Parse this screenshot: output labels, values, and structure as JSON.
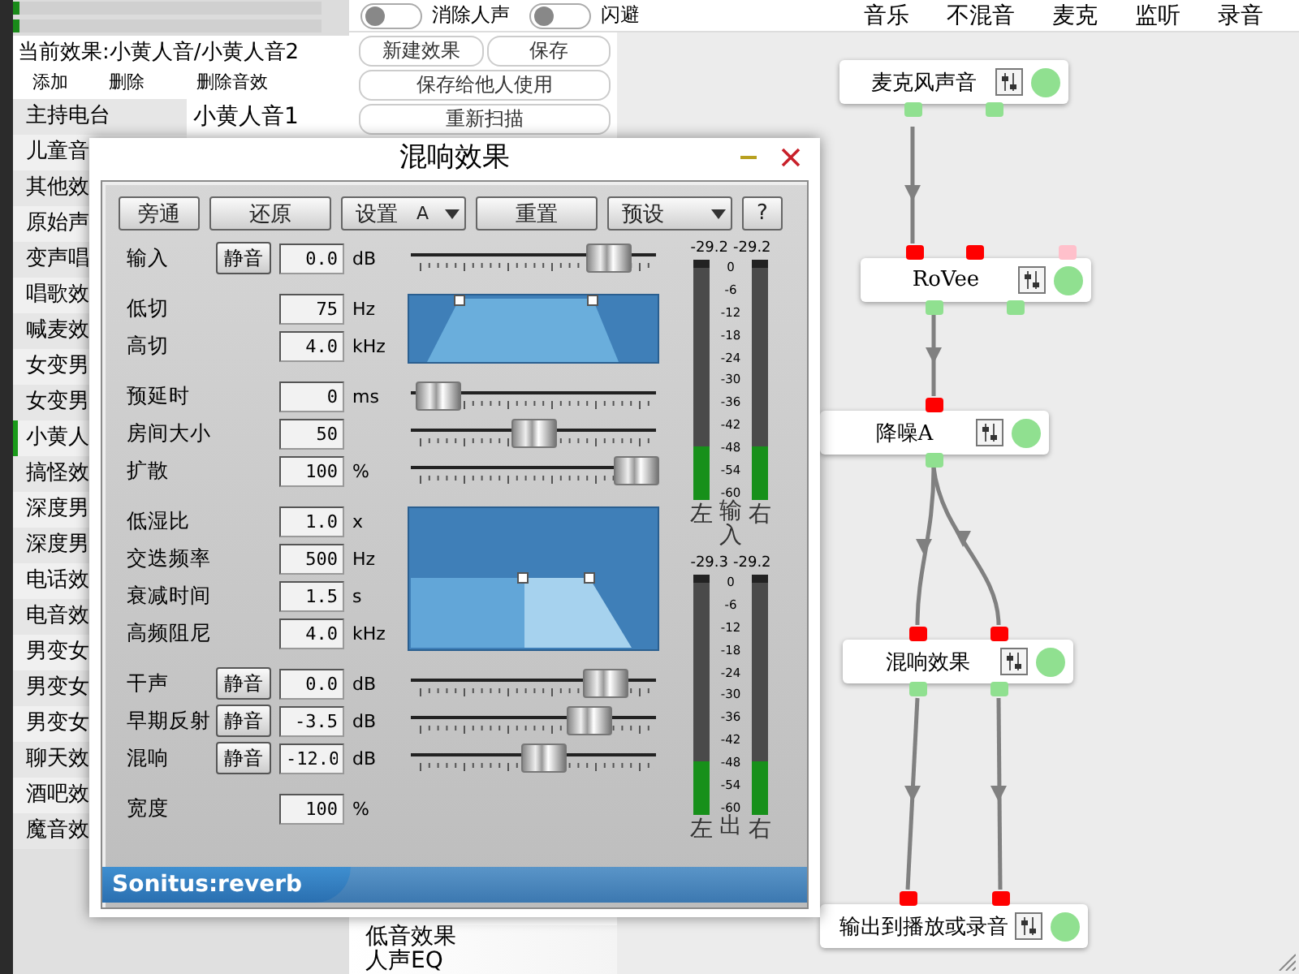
{
  "top_meters": [
    {
      "level": 0.02
    },
    {
      "level": 0.02
    }
  ],
  "current_effect": "当前效果:小黄人音/小黄人音2",
  "effect_actions": [
    "添加",
    "删除",
    "删除音效"
  ],
  "effect_list": [
    {
      "label": "主持电台",
      "selected": false
    },
    {
      "label": "儿童音",
      "selected": false
    },
    {
      "label": "其他效",
      "selected": false
    },
    {
      "label": "原始声",
      "selected": false
    },
    {
      "label": "变声唱",
      "selected": false
    },
    {
      "label": "唱歌效",
      "selected": false
    },
    {
      "label": "喊麦效",
      "selected": false
    },
    {
      "label": "女变男",
      "selected": false
    },
    {
      "label": "女变男",
      "selected": false
    },
    {
      "label": "小黄人",
      "selected": true
    },
    {
      "label": "搞怪效",
      "selected": false
    },
    {
      "label": "深度男",
      "selected": false
    },
    {
      "label": "深度男",
      "selected": false
    },
    {
      "label": "电话效",
      "selected": false
    },
    {
      "label": "电音效",
      "selected": false
    },
    {
      "label": "男变女",
      "selected": false
    },
    {
      "label": "男变女",
      "selected": false
    },
    {
      "label": "男变女",
      "selected": false
    },
    {
      "label": "聊天效",
      "selected": false
    },
    {
      "label": "酒吧效",
      "selected": false
    },
    {
      "label": "魔音效",
      "selected": false
    }
  ],
  "sub_list": [
    {
      "label": "小黄人音1"
    }
  ],
  "top_toggles": [
    {
      "label": "消除人声",
      "on": false
    },
    {
      "label": "闪避",
      "on": false
    }
  ],
  "output_tabs": [
    "音乐",
    "不混音",
    "麦克",
    "监听",
    "录音"
  ],
  "buttons": [
    "新建效果",
    "保存",
    "保存给他人使用",
    "重新扫描"
  ],
  "bottom_list": [
    "低音效果",
    "人声EQ"
  ],
  "graph": {
    "nodes": [
      {
        "label": "麦克风声音",
        "on": true,
        "outputs": [
          {
            "color": "#90e090"
          },
          {
            "color": "#90e090"
          }
        ]
      },
      {
        "label": "RoVee",
        "on": true,
        "inputs": [
          {
            "color": "#ff0000"
          },
          {
            "color": "#ff0000"
          },
          {
            "color": "#ffc0cb"
          }
        ],
        "outputs": [
          {
            "color": "#90e090"
          },
          {
            "color": "#90e090"
          }
        ]
      },
      {
        "label": "降噪A",
        "on": true,
        "inputs": [
          {
            "color": "#ff0000"
          }
        ],
        "outputs": [
          {
            "color": "#90e090"
          }
        ]
      },
      {
        "label": "混响效果",
        "on": true,
        "inputs": [
          {
            "color": "#ff0000"
          },
          {
            "color": "#ff0000"
          }
        ],
        "outputs": [
          {
            "color": "#90e090"
          },
          {
            "color": "#90e090"
          }
        ]
      },
      {
        "label": "输出到播放或录音",
        "on": true,
        "inputs": [
          {
            "color": "#ff0000"
          },
          {
            "color": "#ff0000"
          }
        ]
      }
    ]
  },
  "dialog": {
    "title": "混响效果",
    "toolbar": [
      {
        "kind": "button",
        "label": "旁通"
      },
      {
        "kind": "button",
        "label": "还原"
      },
      {
        "kind": "dropdown",
        "label": "设置",
        "value": "A"
      },
      {
        "kind": "button",
        "label": "重置"
      },
      {
        "kind": "dropdown",
        "label": "预设"
      },
      {
        "kind": "button",
        "label": "?"
      }
    ],
    "sections": [
      {
        "kind": "sliders",
        "rows": [
          {
            "label": "输入",
            "mute": "静音",
            "value": "0.0",
            "unit": "dB",
            "level": 0.87
          }
        ]
      },
      {
        "kind": "filter-graph",
        "rows": [
          {
            "label": "低切",
            "value": "75",
            "unit": "Hz"
          },
          {
            "label": "高切",
            "value": "4.0",
            "unit": "kHz"
          }
        ]
      },
      {
        "kind": "sliders",
        "rows": [
          {
            "label": "预延时",
            "value": "0",
            "unit": "ms",
            "level": 0.04
          },
          {
            "label": "房间大小",
            "value": "50",
            "level": 0.5
          },
          {
            "label": "扩散",
            "value": "100",
            "unit": "%",
            "level": 1.0
          }
        ]
      },
      {
        "kind": "damping-graph",
        "rows": [
          {
            "label": "低湿比",
            "value": "1.0",
            "unit": "x"
          },
          {
            "label": "交迭频率",
            "value": "500",
            "unit": "Hz"
          },
          {
            "label": "衰减时间",
            "value": "1.5",
            "unit": "s"
          },
          {
            "label": "高频阻尼",
            "value": "4.0",
            "unit": "kHz"
          }
        ]
      },
      {
        "kind": "sliders",
        "rows": [
          {
            "label": "干声",
            "mute": "静音",
            "value": "0.0",
            "unit": "dB",
            "level": 0.85
          },
          {
            "label": "早期反射",
            "mute": "静音",
            "value": "-3.5",
            "unit": "dB",
            "level": 0.77
          },
          {
            "label": "混响",
            "mute": "静音",
            "value": "-12.0",
            "unit": "dB",
            "level": 0.55
          }
        ]
      },
      {
        "kind": "fields",
        "rows": [
          {
            "label": "宽度",
            "value": "100",
            "unit": "%"
          }
        ]
      }
    ],
    "meters": [
      {
        "readings": [
          "-29.2",
          "-29.2"
        ],
        "scale": [
          "0",
          "-6",
          "-12",
          "-18",
          "-24",
          "-30",
          "-36",
          "-42",
          "-48",
          "-54",
          "-60"
        ],
        "channels": [
          {
            "label": "左",
            "level": 0.23
          },
          {
            "label": "右",
            "level": 0.23
          }
        ],
        "caption": "输入"
      },
      {
        "readings": [
          "-29.3",
          "-29.2"
        ],
        "scale": [
          "0",
          "-6",
          "-12",
          "-18",
          "-24",
          "-30",
          "-36",
          "-42",
          "-48",
          "-54",
          "-60"
        ],
        "channels": [
          {
            "label": "左",
            "level": 0.23
          },
          {
            "label": "右",
            "level": 0.23
          }
        ],
        "caption": "出"
      }
    ],
    "brand": "Sonitus:reverb"
  }
}
